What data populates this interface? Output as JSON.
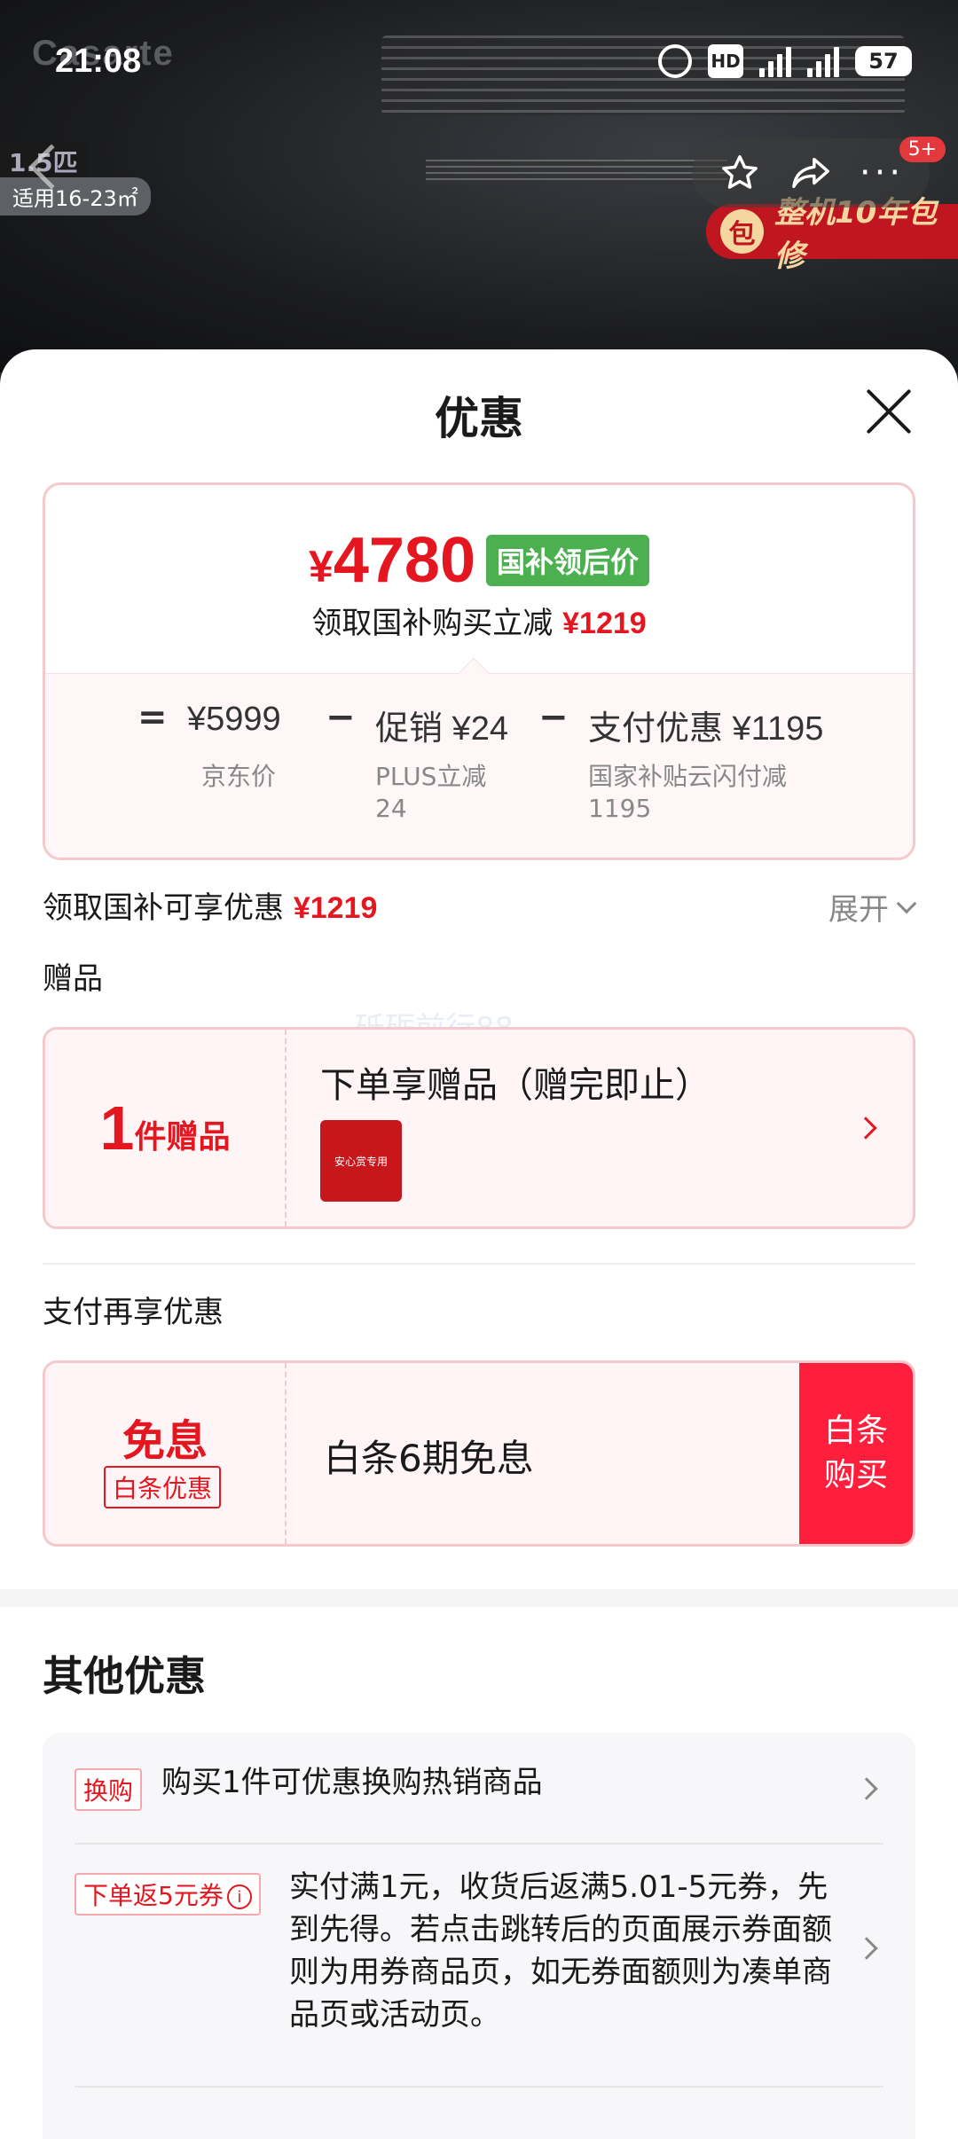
{
  "status_bar": {
    "time": "21:08",
    "hd": "HD",
    "net1": "5G",
    "net2": "5G",
    "battery": "57"
  },
  "hero": {
    "brand": "Casarte",
    "capacity": "1.5匹",
    "area": "适用16-23㎡",
    "warranty_icon": "包",
    "warranty_text": "整机10年包修",
    "badge": "5+"
  },
  "icons": {
    "back": "back-icon",
    "star": "star-icon",
    "share": "share-icon",
    "more": "more-icon",
    "close": "close-icon"
  },
  "sheet": {
    "title": "优惠",
    "price": {
      "currency": "¥",
      "amount": "4780",
      "tag": "国补领后价",
      "sub_text": "领取国补购买立减",
      "sub_amount": "¥1219"
    },
    "breakdown": {
      "equals": "=",
      "jd_price": "¥5999",
      "jd_price_label": "京东价",
      "minus1": "−",
      "promo": "促销 ¥24",
      "promo_label1": "PLUS立减",
      "promo_label2": "24",
      "minus2": "−",
      "pay": "支付优惠 ¥1195",
      "pay_label1": "国家补贴云闪付减",
      "pay_label2": "1195"
    },
    "subsidy_row": {
      "text": "领取国补可享优惠",
      "amount": "¥1219",
      "expand": "展开"
    },
    "gift_section_title": "赠品",
    "gift": {
      "count": "1",
      "unit": "件赠品",
      "title": "下单享赠品（赠完即止）",
      "thumb_text": "安心赏专用"
    },
    "pay_section_title": "支付再享优惠",
    "pay": {
      "big": "免息",
      "small": "白条优惠",
      "desc": "白条6期免息",
      "button": "白条购买"
    },
    "other_title": "其他优惠",
    "other_items": [
      {
        "tag": "换购",
        "text": "购买1件可优惠换购热销商品"
      },
      {
        "tag": "下单返5元券",
        "text": "实付满1元，收货后返满5.01-5元券，先到先得。若点击跳转后的页面展示券面额则为用券商品页，如无券面额则为凑单商品页或活动页。"
      }
    ],
    "watermark": "砥砺前行88"
  }
}
